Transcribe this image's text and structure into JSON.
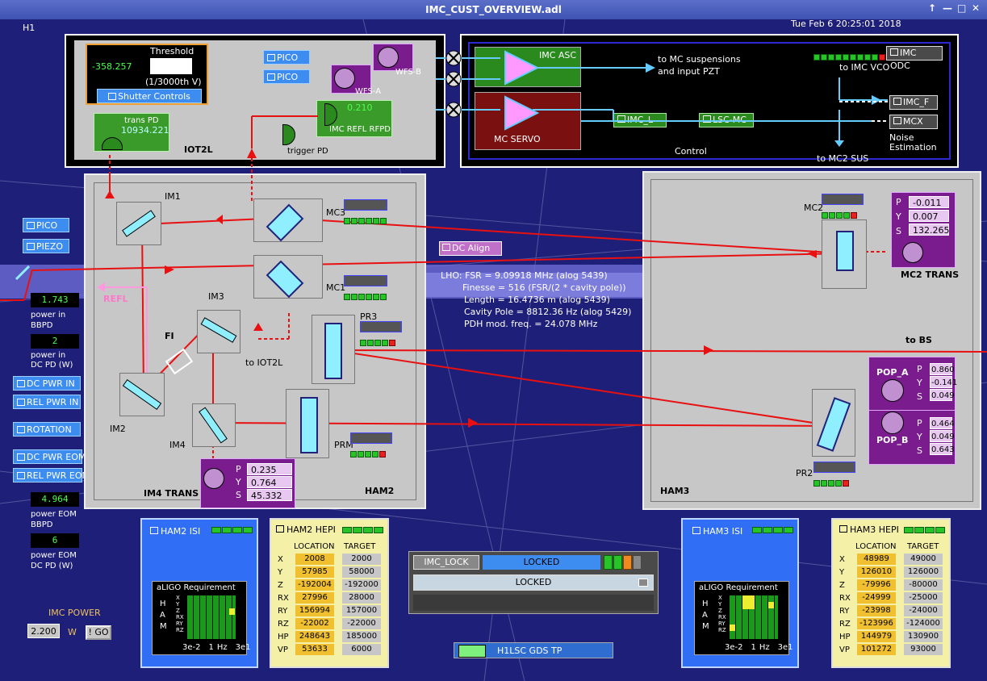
{
  "window": {
    "title": "IMC_CUST_OVERVIEW.adl",
    "controls": [
      "↑",
      "—",
      "□",
      "✕"
    ]
  },
  "site": "H1",
  "timestamp": "Tue Feb  6 20:25:01 2018",
  "iot2l": {
    "label": "IOT2L",
    "threshold_label": "Threshold",
    "threshold_value": "-358.257",
    "threshold_unit": "(1/3000th V)",
    "shutter_button": "Shutter Controls",
    "trans_pd_label": "trans PD",
    "trans_pd_value": "10934.221",
    "pico1": "PICO",
    "pico2": "PICO",
    "wfs_b": "WFS-B",
    "wfs_a": "WFS-A",
    "refl_rfpd_label": "IMC REFL RFPD",
    "refl_rfpd_value": "0.210",
    "trigger_pd": "trigger PD"
  },
  "control": {
    "label": "Control",
    "imc_asc": "IMC ASC",
    "mc_servo": "MC SERVO",
    "to_mc_susp": "to MC suspensions",
    "and_input": "and input PZT",
    "to_vco": "to IMC VCO",
    "imc_odc": "IMC ODC",
    "imc_l": "IMC_L",
    "lsc_mc": "LSC-MC",
    "imc_f": "IMC_F",
    "mcx": "MCX",
    "to_mc2": "to MC2 SUS",
    "noise1": "Noise",
    "noise2": "Estimation"
  },
  "left": {
    "pico": "PICO",
    "piezo": "PIEZO",
    "bbpd_value": "1.743",
    "bbpd_label1": "power in",
    "bbpd_label2": "BBPD",
    "dcpd_value": "2",
    "dcpd_label1": "power in",
    "dcpd_label2": "DC PD (W)",
    "dc_pwr_in": "DC PWR IN",
    "rel_pwr_in": "REL PWR IN",
    "rotation": "ROTATION",
    "dc_pwr_eom": "DC PWR EOM",
    "rel_pwr_eom": "REL PWR EOM",
    "eom_bbpd_value": "4.964",
    "eom_bbpd_label1": "power EOM",
    "eom_bbpd_label2": "BBPD",
    "eom_dcpd_value": "6",
    "eom_dcpd_label1": "power EOM",
    "eom_dcpd_label2": "DC PD (W)",
    "imc_power_label": "IMC POWER",
    "imc_power_value": "2.200",
    "imc_power_unit": "W",
    "go": "! GO"
  },
  "ham2": {
    "label": "HAM2",
    "im1": "IM1",
    "im2": "IM2",
    "im3": "IM3",
    "im4": "IM4",
    "mc1": "MC1",
    "mc3": "MC3",
    "pr3": "PR3",
    "prm": "PRM",
    "fi": "FI",
    "refl": "REFL",
    "to_iot2l": "to IOT2L",
    "im4_trans": "IM4 TRANS",
    "im4_p": "0.235",
    "im4_y": "0.764",
    "im4_s": "45.332"
  },
  "dc_align": "DC Align",
  "lho": {
    "l1": "LHO: FSR = 9.09918 MHz (alog 5439)",
    "l2": "Finesse = 516 (FSR/(2 * cavity pole))",
    "l3": "Length = 16.4736 m (alog 5439)",
    "l4": "Cavity Pole = 8812.36 Hz (alog 5429)",
    "l5": "PDH mod. freq. = 24.078 MHz"
  },
  "ham3": {
    "label": "HAM3",
    "mc2": "MC2",
    "pr2": "PR2",
    "to_bs": "to BS",
    "mc2_trans": "MC2 TRANS",
    "mc2_p": "-0.011",
    "mc2_y": "0.007",
    "mc2_s": "132.265",
    "pop_a": "POP_A",
    "pop_a_p": "0.860",
    "pop_a_y": "-0.141",
    "pop_a_s": "0.049",
    "pop_b": "POP_B",
    "pop_b_p": "0.464",
    "pop_b_y": "0.049",
    "pop_b_s": "0.643"
  },
  "pys": {
    "p": "P",
    "y": "Y",
    "s": "S"
  },
  "ham2_isi": {
    "title": "HAM2 ISI",
    "req": "aLIGO Requirement",
    "ham": [
      "H",
      "A",
      "M"
    ],
    "dofs": [
      "X",
      "Y",
      "Z",
      "RX",
      "RY",
      "RZ"
    ],
    "x1": "3e-2",
    "x2": "1",
    "x3": "Hz",
    "x4": "3e1"
  },
  "ham3_isi": {
    "title": "HAM3 ISI",
    "req": "aLIGO Requirement",
    "ham": [
      "H",
      "A",
      "M"
    ],
    "dofs": [
      "X",
      "Y",
      "Z",
      "RX",
      "RY",
      "RZ"
    ],
    "x1": "3e-2",
    "x2": "1",
    "x3": "Hz",
    "x4": "3e1"
  },
  "ham2_hepi": {
    "title": "HAM2 HEPI",
    "col1": "LOCATION",
    "col2": "TARGET",
    "rows": [
      [
        "X",
        "2008",
        "2000"
      ],
      [
        "Y",
        "57985",
        "58000"
      ],
      [
        "Z",
        "-192004",
        "-192000"
      ],
      [
        "RX",
        "27996",
        "28000"
      ],
      [
        "RY",
        "156994",
        "157000"
      ],
      [
        "RZ",
        "-22002",
        "-22000"
      ],
      [
        "HP",
        "248643",
        "185000"
      ],
      [
        "VP",
        "53633",
        "6000"
      ]
    ]
  },
  "ham3_hepi": {
    "title": "HAM3 HEPI",
    "col1": "LOCATION",
    "col2": "TARGET",
    "rows": [
      [
        "X",
        "48989",
        "49000"
      ],
      [
        "Y",
        "126010",
        "126000"
      ],
      [
        "Z",
        "-79996",
        "-80000"
      ],
      [
        "RX",
        "-24999",
        "-25000"
      ],
      [
        "RY",
        "-23998",
        "-24000"
      ],
      [
        "RZ",
        "-123996",
        "-124000"
      ],
      [
        "HP",
        "144979",
        "130900"
      ],
      [
        "VP",
        "101272",
        "93000"
      ]
    ]
  },
  "guardian": {
    "name": "IMC_LOCK",
    "state": "LOCKED",
    "request": "LOCKED"
  },
  "gds": {
    "label": "H1LSC GDS TP"
  }
}
